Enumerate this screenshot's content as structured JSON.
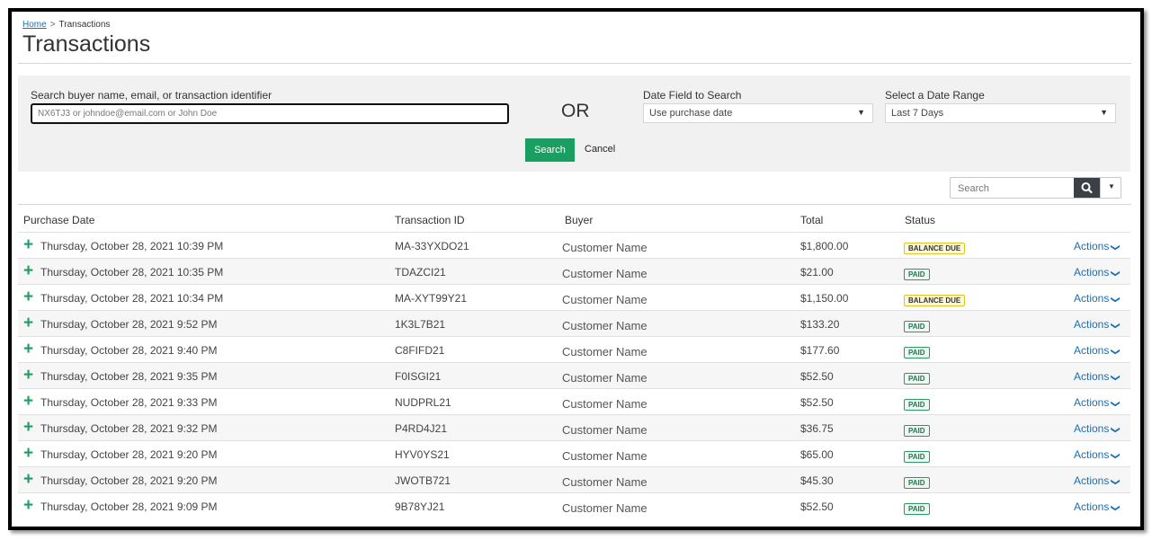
{
  "breadcrumb": {
    "home": "Home",
    "separator": ">",
    "current": "Transactions"
  },
  "page_title": "Transactions",
  "search_form": {
    "buyer_label": "Search buyer name, email, or transaction identifier",
    "buyer_placeholder": "NX6TJ3 or johndoe@email.com or John Doe",
    "or_text": "OR",
    "date_field_label": "Date Field to Search",
    "date_field_value": "Use purchase date",
    "date_range_label": "Select a Date Range",
    "date_range_value": "Last 7 Days",
    "search_button": "Search",
    "cancel_button": "Cancel"
  },
  "table_search": {
    "placeholder": "Search"
  },
  "columns": {
    "purchase_date": "Purchase Date",
    "transaction_id": "Transaction ID",
    "buyer": "Buyer",
    "total": "Total",
    "status": "Status"
  },
  "actions_label": "Actions",
  "colors": {
    "accent_green": "#1a9e62",
    "link_blue": "#1a6fb5",
    "balance_due": "#fff9d6"
  },
  "rows": [
    {
      "date": "Thursday, October 28, 2021 10:39 PM",
      "id": "MA-33YXDO21",
      "buyer": "Customer Name",
      "total": "$1,800.00",
      "status": "BALANCE DUE"
    },
    {
      "date": "Thursday, October 28, 2021 10:35 PM",
      "id": "TDAZCI21",
      "buyer": "Customer Name",
      "total": "$21.00",
      "status": "PAID"
    },
    {
      "date": "Thursday, October 28, 2021 10:34 PM",
      "id": "MA-XYT99Y21",
      "buyer": "Customer Name",
      "total": "$1,150.00",
      "status": "BALANCE DUE"
    },
    {
      "date": "Thursday, October 28, 2021 9:52 PM",
      "id": "1K3L7B21",
      "buyer": "Customer Name",
      "total": "$133.20",
      "status": "PAID"
    },
    {
      "date": "Thursday, October 28, 2021 9:40 PM",
      "id": "C8FIFD21",
      "buyer": "Customer Name",
      "total": "$177.60",
      "status": "PAID"
    },
    {
      "date": "Thursday, October 28, 2021 9:35 PM",
      "id": "F0ISGI21",
      "buyer": "Customer Name",
      "total": "$52.50",
      "status": "PAID"
    },
    {
      "date": "Thursday, October 28, 2021 9:33 PM",
      "id": "NUDPRL21",
      "buyer": "Customer Name",
      "total": "$52.50",
      "status": "PAID"
    },
    {
      "date": "Thursday, October 28, 2021 9:32 PM",
      "id": "P4RD4J21",
      "buyer": "Customer Name",
      "total": "$36.75",
      "status": "PAID"
    },
    {
      "date": "Thursday, October 28, 2021 9:20 PM",
      "id": "HYV0YS21",
      "buyer": "Customer Name",
      "total": "$65.00",
      "status": "PAID"
    },
    {
      "date": "Thursday, October 28, 2021 9:20 PM",
      "id": "JWOTB721",
      "buyer": "Customer Name",
      "total": "$45.30",
      "status": "PAID"
    },
    {
      "date": "Thursday, October 28, 2021 9:09 PM",
      "id": "9B78YJ21",
      "buyer": "Customer Name",
      "total": "$52.50",
      "status": "PAID"
    }
  ]
}
